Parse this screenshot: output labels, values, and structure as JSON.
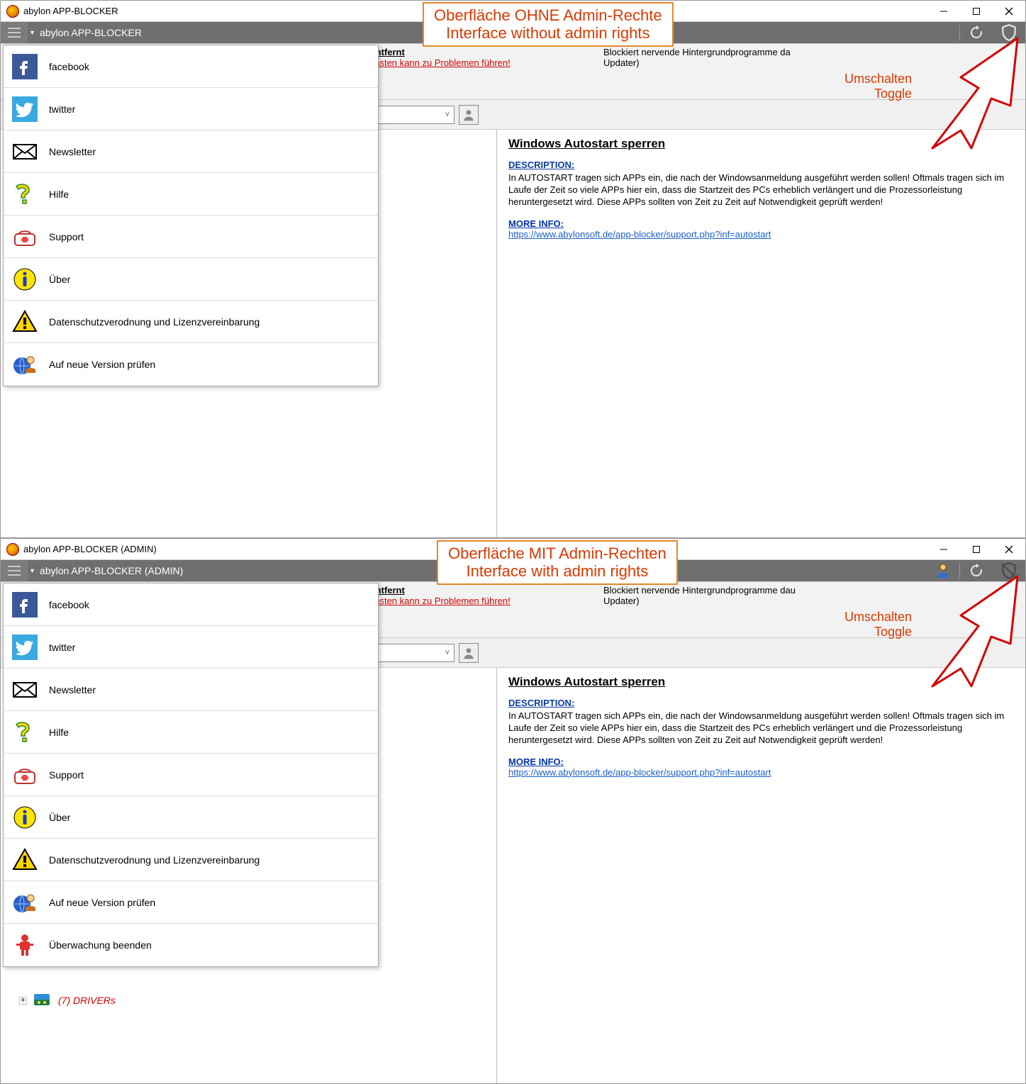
{
  "top_window": {
    "title": "abylon APP-BLOCKER",
    "toolbar_title": "abylon APP-BLOCKER",
    "callout_line1": "Oberfläche OHNE Admin-Rechte",
    "callout_line2": "Interface without admin rights",
    "toggle_l1": "Umschalten",
    "toggle_l2": "Toggle",
    "band_entfernt": "Entfernt",
    "band_warn": "ensten kann zu Problemen führen!",
    "band_right1": "Blockiert nervende Hintergrundprogramme da",
    "band_right2": "Updater)",
    "content_heading": "Windows Autostart sperren",
    "content_desc_label": "DESCRIPTION:",
    "content_desc": "In AUTOSTART tragen sich APPs ein, die nach der Windowsanmeldung ausgeführt werden sollen! Oftmals tragen sich im Laufe der Zeit so viele APPs hier ein, dass die Startzeit des PCs erheblich verlängert und die Prozessorleistung heruntergesetzt wird. Diese APPs sollten von Zeit zu Zeit auf Notwendigkeit geprüft werden!",
    "content_more_label": "MORE INFO:",
    "content_more_link": "https://www.abylonsoft.de/app-blocker/support.php?inf=autostart",
    "menu": [
      {
        "label": "facebook",
        "icon": "facebook"
      },
      {
        "label": "twitter",
        "icon": "twitter"
      },
      {
        "label": "Newsletter",
        "icon": "mail"
      },
      {
        "label": "Hilfe",
        "icon": "question"
      },
      {
        "label": "Support",
        "icon": "support"
      },
      {
        "label": "Über",
        "icon": "info"
      },
      {
        "label": "Datenschutzverodnung und Lizenzvereinbarung",
        "icon": "warning"
      },
      {
        "label": "Auf neue Version prüfen",
        "icon": "globe-user"
      }
    ]
  },
  "bottom_window": {
    "title": "abylon APP-BLOCKER (ADMIN)",
    "toolbar_title": "abylon APP-BLOCKER (ADMIN)",
    "callout_line1": "Oberfläche MIT Admin-Rechten",
    "callout_line2": "Interface with admin rights",
    "toggle_l1": "Umschalten",
    "toggle_l2": "Toggle",
    "band_entfernt": "Entfernt",
    "band_warn": "ensten kann zu Problemen führen!",
    "band_right1": "Blockiert nervende Hintergrundprogramme dau",
    "band_right2": "Updater)",
    "content_heading": "Windows Autostart sperren",
    "content_desc_label": "DESCRIPTION:",
    "content_desc": "In AUTOSTART tragen sich APPs ein, die nach der Windowsanmeldung ausgeführt werden sollen! Oftmals tragen sich im Laufe der Zeit so viele APPs hier ein, dass die Startzeit des PCs erheblich verlängert und die Prozessorleistung heruntergesetzt wird. Diese APPs sollten von Zeit zu Zeit auf Notwendigkeit geprüft werden!",
    "content_more_label": "MORE INFO:",
    "content_more_link": "https://www.abylonsoft.de/app-blocker/support.php?inf=autostart",
    "menu": [
      {
        "label": "facebook",
        "icon": "facebook"
      },
      {
        "label": "twitter",
        "icon": "twitter"
      },
      {
        "label": "Newsletter",
        "icon": "mail"
      },
      {
        "label": "Hilfe",
        "icon": "question"
      },
      {
        "label": "Support",
        "icon": "support"
      },
      {
        "label": "Über",
        "icon": "info"
      },
      {
        "label": "Datenschutzverodnung und Lizenzvereinbarung",
        "icon": "warning"
      },
      {
        "label": "Auf neue Version prüfen",
        "icon": "globe-user"
      },
      {
        "label": "Überwachung beenden",
        "icon": "stop-person"
      }
    ],
    "drivers_label": "(7) DRIVERs"
  }
}
